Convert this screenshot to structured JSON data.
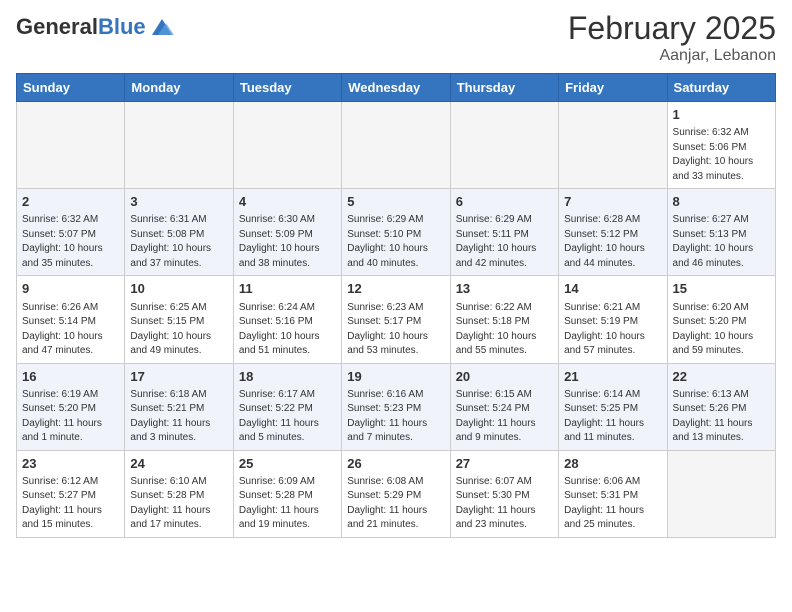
{
  "header": {
    "logo_general": "General",
    "logo_blue": "Blue",
    "month_title": "February 2025",
    "location": "Aanjar, Lebanon"
  },
  "days_of_week": [
    "Sunday",
    "Monday",
    "Tuesday",
    "Wednesday",
    "Thursday",
    "Friday",
    "Saturday"
  ],
  "weeks": [
    [
      {
        "day": "",
        "info": ""
      },
      {
        "day": "",
        "info": ""
      },
      {
        "day": "",
        "info": ""
      },
      {
        "day": "",
        "info": ""
      },
      {
        "day": "",
        "info": ""
      },
      {
        "day": "",
        "info": ""
      },
      {
        "day": "1",
        "info": "Sunrise: 6:32 AM\nSunset: 5:06 PM\nDaylight: 10 hours\nand 33 minutes."
      }
    ],
    [
      {
        "day": "2",
        "info": "Sunrise: 6:32 AM\nSunset: 5:07 PM\nDaylight: 10 hours\nand 35 minutes."
      },
      {
        "day": "3",
        "info": "Sunrise: 6:31 AM\nSunset: 5:08 PM\nDaylight: 10 hours\nand 37 minutes."
      },
      {
        "day": "4",
        "info": "Sunrise: 6:30 AM\nSunset: 5:09 PM\nDaylight: 10 hours\nand 38 minutes."
      },
      {
        "day": "5",
        "info": "Sunrise: 6:29 AM\nSunset: 5:10 PM\nDaylight: 10 hours\nand 40 minutes."
      },
      {
        "day": "6",
        "info": "Sunrise: 6:29 AM\nSunset: 5:11 PM\nDaylight: 10 hours\nand 42 minutes."
      },
      {
        "day": "7",
        "info": "Sunrise: 6:28 AM\nSunset: 5:12 PM\nDaylight: 10 hours\nand 44 minutes."
      },
      {
        "day": "8",
        "info": "Sunrise: 6:27 AM\nSunset: 5:13 PM\nDaylight: 10 hours\nand 46 minutes."
      }
    ],
    [
      {
        "day": "9",
        "info": "Sunrise: 6:26 AM\nSunset: 5:14 PM\nDaylight: 10 hours\nand 47 minutes."
      },
      {
        "day": "10",
        "info": "Sunrise: 6:25 AM\nSunset: 5:15 PM\nDaylight: 10 hours\nand 49 minutes."
      },
      {
        "day": "11",
        "info": "Sunrise: 6:24 AM\nSunset: 5:16 PM\nDaylight: 10 hours\nand 51 minutes."
      },
      {
        "day": "12",
        "info": "Sunrise: 6:23 AM\nSunset: 5:17 PM\nDaylight: 10 hours\nand 53 minutes."
      },
      {
        "day": "13",
        "info": "Sunrise: 6:22 AM\nSunset: 5:18 PM\nDaylight: 10 hours\nand 55 minutes."
      },
      {
        "day": "14",
        "info": "Sunrise: 6:21 AM\nSunset: 5:19 PM\nDaylight: 10 hours\nand 57 minutes."
      },
      {
        "day": "15",
        "info": "Sunrise: 6:20 AM\nSunset: 5:20 PM\nDaylight: 10 hours\nand 59 minutes."
      }
    ],
    [
      {
        "day": "16",
        "info": "Sunrise: 6:19 AM\nSunset: 5:20 PM\nDaylight: 11 hours\nand 1 minute."
      },
      {
        "day": "17",
        "info": "Sunrise: 6:18 AM\nSunset: 5:21 PM\nDaylight: 11 hours\nand 3 minutes."
      },
      {
        "day": "18",
        "info": "Sunrise: 6:17 AM\nSunset: 5:22 PM\nDaylight: 11 hours\nand 5 minutes."
      },
      {
        "day": "19",
        "info": "Sunrise: 6:16 AM\nSunset: 5:23 PM\nDaylight: 11 hours\nand 7 minutes."
      },
      {
        "day": "20",
        "info": "Sunrise: 6:15 AM\nSunset: 5:24 PM\nDaylight: 11 hours\nand 9 minutes."
      },
      {
        "day": "21",
        "info": "Sunrise: 6:14 AM\nSunset: 5:25 PM\nDaylight: 11 hours\nand 11 minutes."
      },
      {
        "day": "22",
        "info": "Sunrise: 6:13 AM\nSunset: 5:26 PM\nDaylight: 11 hours\nand 13 minutes."
      }
    ],
    [
      {
        "day": "23",
        "info": "Sunrise: 6:12 AM\nSunset: 5:27 PM\nDaylight: 11 hours\nand 15 minutes."
      },
      {
        "day": "24",
        "info": "Sunrise: 6:10 AM\nSunset: 5:28 PM\nDaylight: 11 hours\nand 17 minutes."
      },
      {
        "day": "25",
        "info": "Sunrise: 6:09 AM\nSunset: 5:28 PM\nDaylight: 11 hours\nand 19 minutes."
      },
      {
        "day": "26",
        "info": "Sunrise: 6:08 AM\nSunset: 5:29 PM\nDaylight: 11 hours\nand 21 minutes."
      },
      {
        "day": "27",
        "info": "Sunrise: 6:07 AM\nSunset: 5:30 PM\nDaylight: 11 hours\nand 23 minutes."
      },
      {
        "day": "28",
        "info": "Sunrise: 6:06 AM\nSunset: 5:31 PM\nDaylight: 11 hours\nand 25 minutes."
      },
      {
        "day": "",
        "info": ""
      }
    ]
  ]
}
